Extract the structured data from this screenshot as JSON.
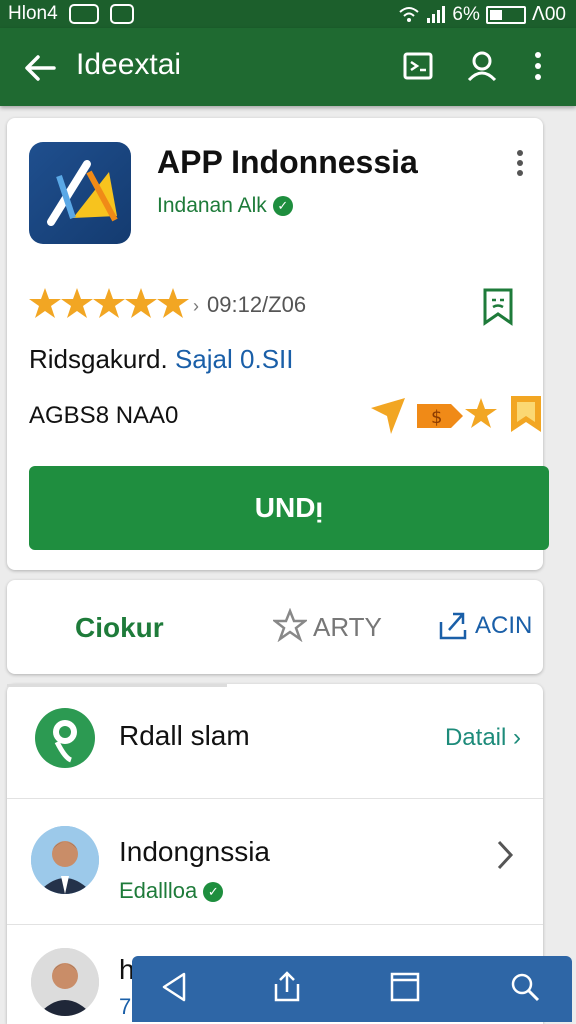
{
  "status_bar": {
    "carrier": "Hlon4",
    "battery_percent": "6%",
    "time": "ᐱ00"
  },
  "app_bar": {
    "title": "Ideextai"
  },
  "app": {
    "name": "APP Indonnessia",
    "developer": "Indanan Alk",
    "rating_stars": 5,
    "rating_text": "09:12/Z06",
    "line1_text": "Ridsgakurd.",
    "line1_link": "Sajal 0.SII",
    "line2_text": "AGBS8 NAA0",
    "install_label": "UNDᴉ"
  },
  "tabs": {
    "tab1": "Ciokur",
    "tab2": "ARTY",
    "tab3": "ACIN"
  },
  "section": {
    "title": "Rdall slam",
    "action": "Datail ›"
  },
  "list": {
    "item1_title": "Indongnssia",
    "item1_sub": "Edallloa",
    "item2_title": "h",
    "item2_sub": "7"
  },
  "colors": {
    "brand_green": "#1f6a31",
    "install_green": "#1f8e3f",
    "link_blue": "#1a5fa8",
    "star": "#f2a623",
    "bottom_bar": "#2e66a6"
  }
}
